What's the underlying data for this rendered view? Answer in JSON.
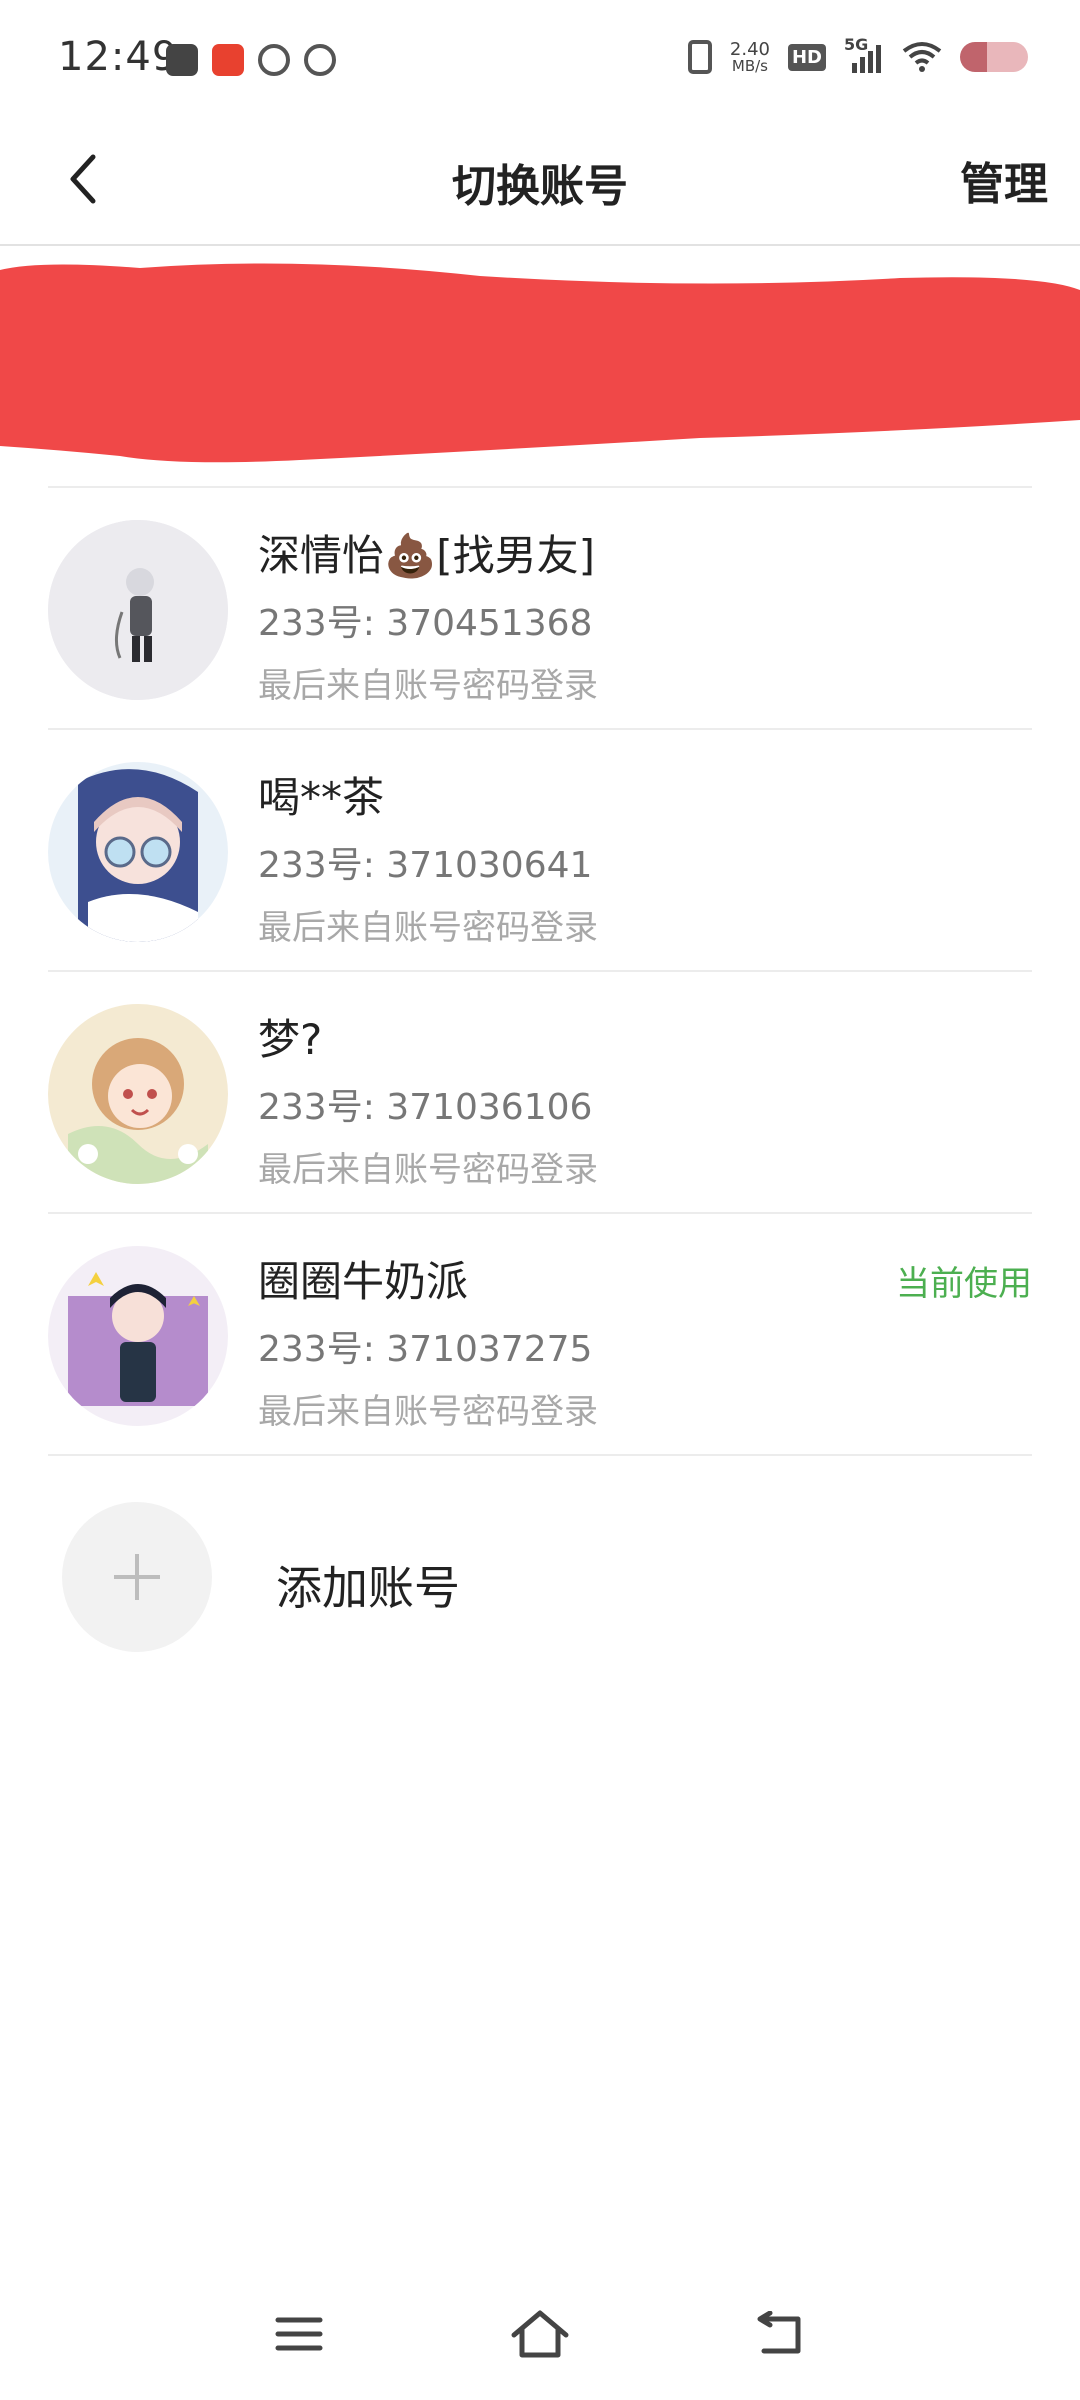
{
  "status_bar": {
    "time": "12:49",
    "net_speed_value": "2.40",
    "net_speed_unit": "MB/s",
    "hd_label": "HD",
    "network_label": "5G"
  },
  "header": {
    "title": "切换账号",
    "manage_label": "管理"
  },
  "accounts": [
    {
      "name": "深情怡💩[找男友]",
      "id": "233号: 370451368",
      "login": "最后来自账号密码登录"
    },
    {
      "name": "喝**茶",
      "id": "233号: 371030641",
      "login": "最后来自账号密码登录"
    },
    {
      "name": "梦?",
      "id": "233号: 371036106",
      "login": "最后来自账号密码登录"
    },
    {
      "name": "圈圈牛奶派",
      "id": "233号: 371037275",
      "login": "最后来自账号密码登录",
      "tag": "当前使用"
    }
  ],
  "add_account_label": "添加账号",
  "colors": {
    "accent_green": "#4caf50",
    "redaction_red": "#f04848"
  }
}
